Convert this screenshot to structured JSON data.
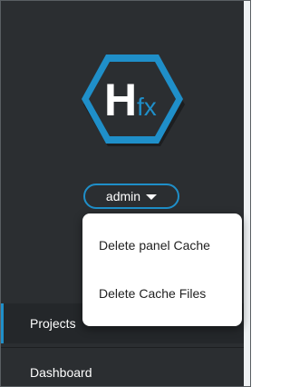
{
  "logo": {
    "letter_main": "H",
    "letter_sub": "fx",
    "accent_color": "#1f8fc9",
    "background_color": "#2b2e31"
  },
  "user_menu": {
    "username": "admin",
    "items": [
      {
        "label": "Delete panel Cache"
      },
      {
        "label": "Delete Cache Files"
      }
    ]
  },
  "nav": {
    "items": [
      {
        "label": "Projects",
        "active": true
      },
      {
        "label": "Dashboard",
        "active": false
      }
    ]
  }
}
